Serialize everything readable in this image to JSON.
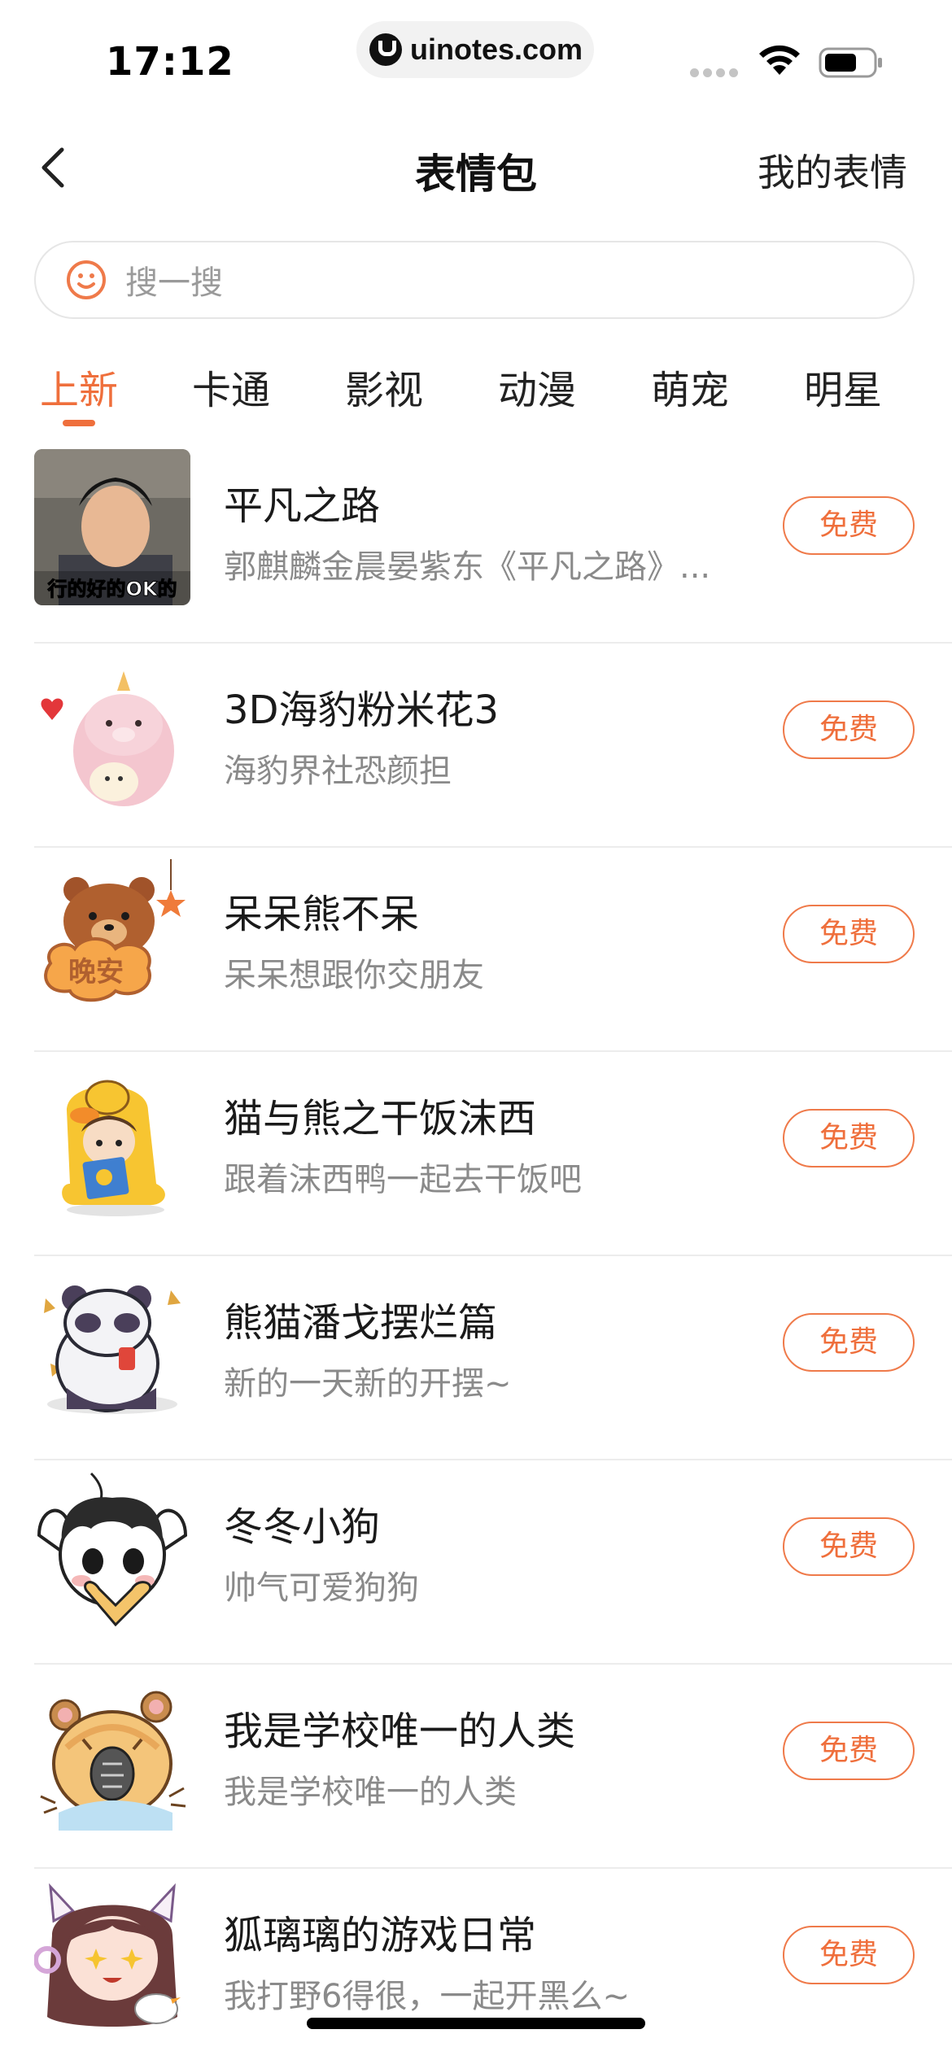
{
  "status_bar": {
    "time": "17:12",
    "url": "uinotes.com"
  },
  "nav": {
    "title": "表情包",
    "right_label": "我的表情"
  },
  "search": {
    "placeholder": "搜一搜"
  },
  "tabs": [
    {
      "label": "上新",
      "active": true
    },
    {
      "label": "卡通",
      "active": false
    },
    {
      "label": "影视",
      "active": false
    },
    {
      "label": "动漫",
      "active": false
    },
    {
      "label": "萌宠",
      "active": false
    },
    {
      "label": "明星",
      "active": false
    }
  ],
  "packs": [
    {
      "title": "平凡之路",
      "subtitle": "郭麒麟金晨晏紫东《平凡之路》...",
      "button": "免费",
      "thumb_caption": "行的好的OK的"
    },
    {
      "title": "3D海豹粉米花3",
      "subtitle": "海豹界社恐颜担",
      "button": "免费"
    },
    {
      "title": "呆呆熊不呆",
      "subtitle": "呆呆想跟你交朋友",
      "button": "免费",
      "thumb_caption": "晚安"
    },
    {
      "title": "猫与熊之干饭沫西",
      "subtitle": "跟着沫西鸭一起去干饭吧",
      "button": "免费"
    },
    {
      "title": "熊猫潘戈摆烂篇",
      "subtitle": "新的一天新的开摆~",
      "button": "免费"
    },
    {
      "title": "冬冬小狗",
      "subtitle": "帅气可爱狗狗",
      "button": "免费"
    },
    {
      "title": "我是学校唯一的人类",
      "subtitle": "我是学校唯一的人类",
      "button": "免费"
    },
    {
      "title": "狐璃璃的游戏日常",
      "subtitle": "我打野6得很，一起开黑么~",
      "button": "免费"
    }
  ],
  "colors": {
    "accent": "#ef6f3c",
    "subtitle": "#8a8a8a",
    "divider": "#ececec"
  }
}
